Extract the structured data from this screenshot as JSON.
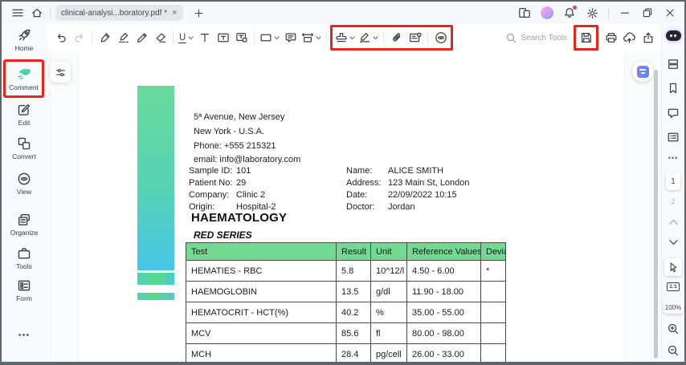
{
  "window": {
    "titlebar": {
      "tab_title": "clinical-analysi...boratory.pdf *",
      "tab_modified": true
    }
  },
  "toolbar": {
    "search_label": "Search Tools"
  },
  "left_sidebar": {
    "items": [
      {
        "label": "Home"
      },
      {
        "label": "Comment",
        "active": true,
        "highlighted": true
      },
      {
        "label": "Edit"
      },
      {
        "label": "Convert"
      },
      {
        "label": "View"
      },
      {
        "label": "Organize"
      },
      {
        "label": "Tools"
      },
      {
        "label": "Form"
      }
    ],
    "more_label": "•••"
  },
  "right_sidebar": {
    "page_current": "1",
    "page_next": "2",
    "fit_label": "1:1",
    "zoom_level": "100%",
    "more_label": "•••"
  },
  "document": {
    "header_address": [
      "5ª Avenue, New Jersey",
      "New York - U.S.A.",
      "Phone: +555 215321",
      "email: info@laboratory.com"
    ],
    "info": {
      "left": [
        {
          "label": "Sample ID:",
          "value": "101"
        },
        {
          "label": "Patient No:",
          "value": "29"
        },
        {
          "label": "Company:",
          "value": "Clinic 2"
        },
        {
          "label": "Origin:",
          "value": "Hospital-2"
        }
      ],
      "right": [
        {
          "label": "Name:",
          "value": "ALICE SMITH"
        },
        {
          "label": "Address:",
          "value": "123 Main St, London"
        },
        {
          "label": "Date:",
          "value": "22/09/2022 10:15"
        },
        {
          "label": "Doctor:",
          "value": "Jordan"
        }
      ]
    },
    "section_title": "HAEMATOLOGY",
    "subsection_title": "RED SERIES",
    "table": {
      "headers": [
        "Test",
        "Result",
        "Unit",
        "Reference Values",
        "Deviation"
      ],
      "rows": [
        [
          "HEMATIES - RBC",
          "5.8",
          "10^12/l",
          "4.50 - 6.00",
          "*"
        ],
        [
          "HAEMOGLOBIN",
          "13.5",
          "g/dl",
          "11.90 - 18.00",
          ""
        ],
        [
          "HEMATOCRIT - HCT(%)",
          "40.2",
          "%",
          "35.00 - 55.00",
          ""
        ],
        [
          "MCV",
          "85.6",
          "fl",
          "80.00 - 98.00",
          ""
        ],
        [
          "MCH",
          "28.4",
          "pg/cell",
          "26.00 - 33.00",
          ""
        ]
      ]
    }
  },
  "annotations": {
    "highlight_color": "#e8251d",
    "highlighted_targets": [
      "comment-sidebar-item",
      "stamp-signature-attachment-eye-toolbar-group",
      "save-button"
    ]
  },
  "colors": {
    "table_header_green": "#72d892",
    "gradient_bar_top": "#69da9c",
    "gradient_bar_bottom": "#47c6e8",
    "toolbar_bg": "#ffffff",
    "chrome_bg": "#f7f9fc"
  },
  "icons": {
    "hamburger-icon": "≡",
    "home-icon": "⌂",
    "plus-icon": "+",
    "close-icon": "×",
    "bell-icon": "bell",
    "gear-icon": "gear",
    "minimize-icon": "—",
    "maximize-icon": "❐",
    "window-close-icon": "✕",
    "undo-icon": "↶",
    "redo-icon": "↷",
    "search-icon": "🔍",
    "save-icon": "💾",
    "print-icon": "🖶",
    "eye-icon": "◉",
    "more-icon": "•••"
  }
}
